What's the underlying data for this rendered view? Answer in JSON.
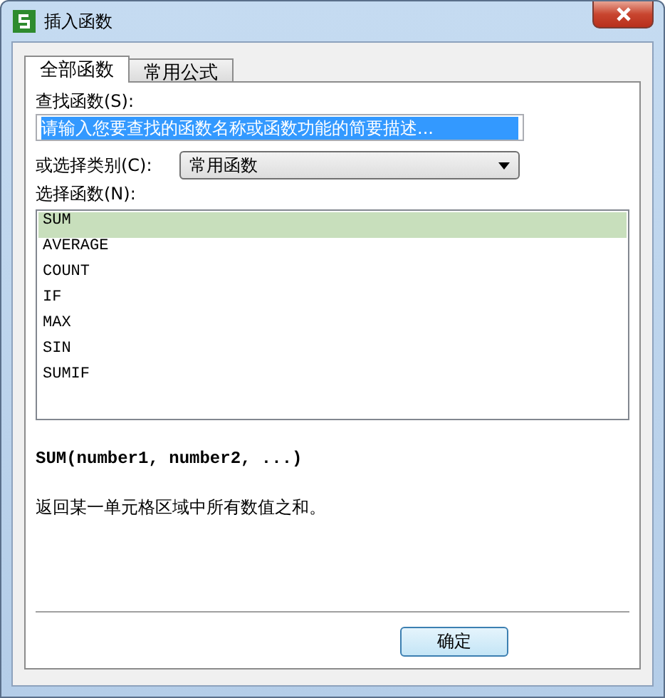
{
  "window": {
    "title": "插入函数"
  },
  "tabs": [
    {
      "label": "全部函数",
      "selected": true
    },
    {
      "label": "常用公式",
      "selected": false
    }
  ],
  "search": {
    "label": "查找函数(S):",
    "placeholder": "请输入您要查找的函数名称或函数功能的简要描述..."
  },
  "category": {
    "label": "或选择类别(C):",
    "value": "常用函数"
  },
  "function_list": {
    "label": "选择函数(N):",
    "items": [
      {
        "name": "SUM",
        "selected": true
      },
      {
        "name": "AVERAGE",
        "selected": false
      },
      {
        "name": "COUNT",
        "selected": false
      },
      {
        "name": "IF",
        "selected": false
      },
      {
        "name": "MAX",
        "selected": false
      },
      {
        "name": "SIN",
        "selected": false
      },
      {
        "name": "SUMIF",
        "selected": false
      }
    ]
  },
  "signature": "SUM(number1, number2, ...)",
  "description": "返回某一单元格区域中所有数值之和。",
  "buttons": [
    "确定"
  ]
}
